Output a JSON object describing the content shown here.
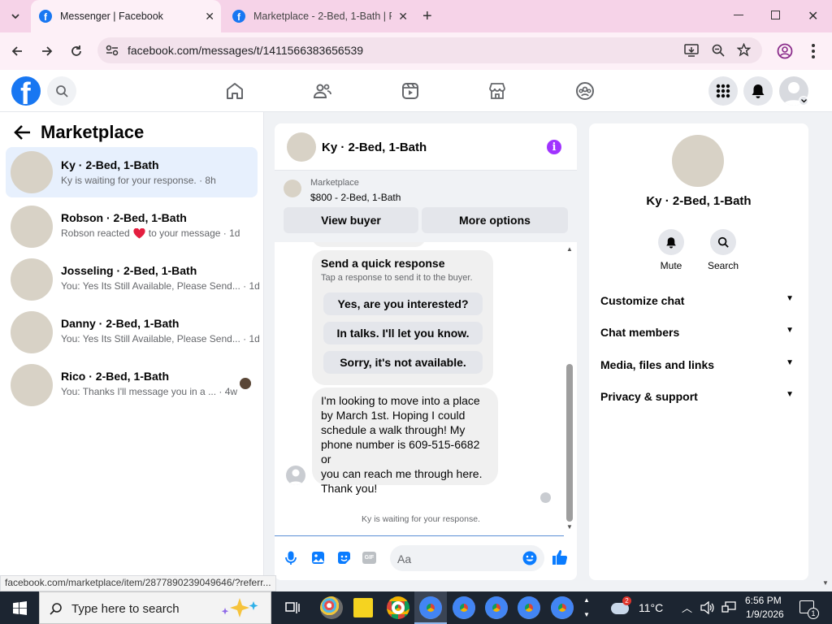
{
  "browser": {
    "tabs": [
      {
        "title": "Messenger | Facebook"
      },
      {
        "title": "Marketplace - 2-Bed, 1-Bath | F"
      }
    ],
    "url": "facebook.com/messages/t/1411566383656539",
    "status_url": "facebook.com/marketplace/item/2877890239049646/?referr..."
  },
  "left_panel": {
    "title": "Marketplace",
    "conversations": [
      {
        "name": "Ky · 2-Bed, 1-Bath",
        "preview": "Ky is waiting for your response. · 8h"
      },
      {
        "name": "Robson · 2-Bed, 1-Bath",
        "preview_before": "Robson reacted",
        "preview_after": "to your message · 1d"
      },
      {
        "name": "Josseling · 2-Bed, 1-Bath",
        "preview": "You: Yes Its Still Available, Please Send... · 1d"
      },
      {
        "name": "Danny · 2-Bed, 1-Bath",
        "preview": "You: Yes Its Still Available, Please Send... · 1d"
      },
      {
        "name": "Rico · 2-Bed, 1-Bath",
        "preview": "You: Thanks I'll message you in a ... · 4w"
      }
    ]
  },
  "chat": {
    "title": "Ky · 2-Bed, 1-Bath",
    "listing_label": "Marketplace",
    "listing_detail": "$800 - 2-Bed, 1-Bath",
    "view_buyer": "View buyer",
    "more_options": "More options",
    "quick_response_title": "Send a quick response",
    "quick_response_sub": "Tap a response to send it to the buyer.",
    "quick_responses": [
      "Yes, are you interested?",
      "In talks. I'll let you know.",
      "Sorry, it's not available."
    ],
    "message_lines": [
      "I'm looking to move into a place",
      "by March 1st. Hoping I could",
      "schedule a walk through! My",
      "phone number is 609-515-6682 or",
      "you can reach me through here.",
      "Thank you!"
    ],
    "waiting_text": "Ky is waiting for your response.",
    "composer_placeholder": "Aa"
  },
  "right_panel": {
    "title": "Ky · 2-Bed, 1-Bath",
    "mute": "Mute",
    "search": "Search",
    "sections": [
      "Customize chat",
      "Chat members",
      "Media, files and links",
      "Privacy & support"
    ]
  },
  "taskbar": {
    "search_placeholder": "Type here to search",
    "temperature": "11°C",
    "time": "6:56 PM",
    "date": "1/9/2026",
    "notification_count": "1",
    "weather_badge": "2"
  },
  "colors": {
    "fb_blue": "#1877f2",
    "messenger_purple": "#a033ff",
    "heart": "#e41e3f"
  }
}
